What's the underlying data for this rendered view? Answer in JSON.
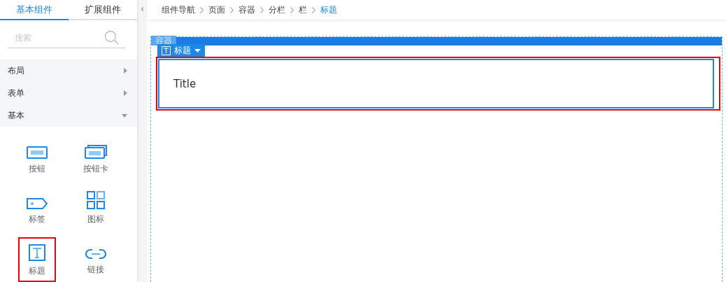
{
  "tabs": [
    {
      "label": "基本组件",
      "selected": true
    },
    {
      "label": "扩展组件",
      "selected": false
    }
  ],
  "search": {
    "placeholder": "搜索"
  },
  "categories": [
    {
      "label": "布局",
      "expanded": false
    },
    {
      "label": "表单",
      "expanded": false
    },
    {
      "label": "基本",
      "expanded": true
    }
  ],
  "components": [
    {
      "label": "按钮",
      "kind": "button",
      "selected": false
    },
    {
      "label": "按钮卡",
      "kind": "button-card",
      "selected": false
    },
    {
      "label": "标签",
      "kind": "tag",
      "selected": false
    },
    {
      "label": "图标",
      "kind": "grid",
      "selected": false
    },
    {
      "label": "标题",
      "kind": "title",
      "selected": true
    },
    {
      "label": "链接",
      "kind": "link",
      "selected": false
    }
  ],
  "breadcrumb": [
    "组件导航",
    "页面",
    "容器",
    "分栏",
    "栏",
    "标题"
  ],
  "canvas": {
    "container_label": "容器",
    "toolbar_label": "标题",
    "title_text": "Title"
  }
}
